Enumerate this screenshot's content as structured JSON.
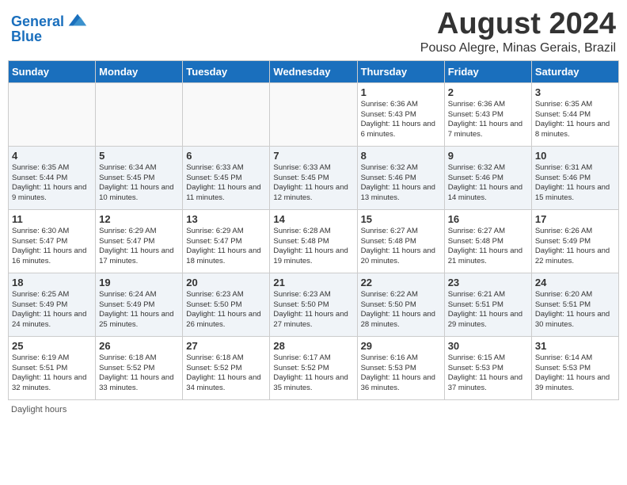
{
  "header": {
    "logo_line1": "General",
    "logo_line2": "Blue",
    "month": "August 2024",
    "location": "Pouso Alegre, Minas Gerais, Brazil"
  },
  "days_of_week": [
    "Sunday",
    "Monday",
    "Tuesday",
    "Wednesday",
    "Thursday",
    "Friday",
    "Saturday"
  ],
  "footer": {
    "label": "Daylight hours"
  },
  "weeks": [
    [
      {
        "num": "",
        "info": ""
      },
      {
        "num": "",
        "info": ""
      },
      {
        "num": "",
        "info": ""
      },
      {
        "num": "",
        "info": ""
      },
      {
        "num": "1",
        "info": "Sunrise: 6:36 AM\nSunset: 5:43 PM\nDaylight: 11 hours and 6 minutes."
      },
      {
        "num": "2",
        "info": "Sunrise: 6:36 AM\nSunset: 5:43 PM\nDaylight: 11 hours and 7 minutes."
      },
      {
        "num": "3",
        "info": "Sunrise: 6:35 AM\nSunset: 5:44 PM\nDaylight: 11 hours and 8 minutes."
      }
    ],
    [
      {
        "num": "4",
        "info": "Sunrise: 6:35 AM\nSunset: 5:44 PM\nDaylight: 11 hours and 9 minutes."
      },
      {
        "num": "5",
        "info": "Sunrise: 6:34 AM\nSunset: 5:45 PM\nDaylight: 11 hours and 10 minutes."
      },
      {
        "num": "6",
        "info": "Sunrise: 6:33 AM\nSunset: 5:45 PM\nDaylight: 11 hours and 11 minutes."
      },
      {
        "num": "7",
        "info": "Sunrise: 6:33 AM\nSunset: 5:45 PM\nDaylight: 11 hours and 12 minutes."
      },
      {
        "num": "8",
        "info": "Sunrise: 6:32 AM\nSunset: 5:46 PM\nDaylight: 11 hours and 13 minutes."
      },
      {
        "num": "9",
        "info": "Sunrise: 6:32 AM\nSunset: 5:46 PM\nDaylight: 11 hours and 14 minutes."
      },
      {
        "num": "10",
        "info": "Sunrise: 6:31 AM\nSunset: 5:46 PM\nDaylight: 11 hours and 15 minutes."
      }
    ],
    [
      {
        "num": "11",
        "info": "Sunrise: 6:30 AM\nSunset: 5:47 PM\nDaylight: 11 hours and 16 minutes."
      },
      {
        "num": "12",
        "info": "Sunrise: 6:29 AM\nSunset: 5:47 PM\nDaylight: 11 hours and 17 minutes."
      },
      {
        "num": "13",
        "info": "Sunrise: 6:29 AM\nSunset: 5:47 PM\nDaylight: 11 hours and 18 minutes."
      },
      {
        "num": "14",
        "info": "Sunrise: 6:28 AM\nSunset: 5:48 PM\nDaylight: 11 hours and 19 minutes."
      },
      {
        "num": "15",
        "info": "Sunrise: 6:27 AM\nSunset: 5:48 PM\nDaylight: 11 hours and 20 minutes."
      },
      {
        "num": "16",
        "info": "Sunrise: 6:27 AM\nSunset: 5:48 PM\nDaylight: 11 hours and 21 minutes."
      },
      {
        "num": "17",
        "info": "Sunrise: 6:26 AM\nSunset: 5:49 PM\nDaylight: 11 hours and 22 minutes."
      }
    ],
    [
      {
        "num": "18",
        "info": "Sunrise: 6:25 AM\nSunset: 5:49 PM\nDaylight: 11 hours and 24 minutes."
      },
      {
        "num": "19",
        "info": "Sunrise: 6:24 AM\nSunset: 5:49 PM\nDaylight: 11 hours and 25 minutes."
      },
      {
        "num": "20",
        "info": "Sunrise: 6:23 AM\nSunset: 5:50 PM\nDaylight: 11 hours and 26 minutes."
      },
      {
        "num": "21",
        "info": "Sunrise: 6:23 AM\nSunset: 5:50 PM\nDaylight: 11 hours and 27 minutes."
      },
      {
        "num": "22",
        "info": "Sunrise: 6:22 AM\nSunset: 5:50 PM\nDaylight: 11 hours and 28 minutes."
      },
      {
        "num": "23",
        "info": "Sunrise: 6:21 AM\nSunset: 5:51 PM\nDaylight: 11 hours and 29 minutes."
      },
      {
        "num": "24",
        "info": "Sunrise: 6:20 AM\nSunset: 5:51 PM\nDaylight: 11 hours and 30 minutes."
      }
    ],
    [
      {
        "num": "25",
        "info": "Sunrise: 6:19 AM\nSunset: 5:51 PM\nDaylight: 11 hours and 32 minutes."
      },
      {
        "num": "26",
        "info": "Sunrise: 6:18 AM\nSunset: 5:52 PM\nDaylight: 11 hours and 33 minutes."
      },
      {
        "num": "27",
        "info": "Sunrise: 6:18 AM\nSunset: 5:52 PM\nDaylight: 11 hours and 34 minutes."
      },
      {
        "num": "28",
        "info": "Sunrise: 6:17 AM\nSunset: 5:52 PM\nDaylight: 11 hours and 35 minutes."
      },
      {
        "num": "29",
        "info": "Sunrise: 6:16 AM\nSunset: 5:53 PM\nDaylight: 11 hours and 36 minutes."
      },
      {
        "num": "30",
        "info": "Sunrise: 6:15 AM\nSunset: 5:53 PM\nDaylight: 11 hours and 37 minutes."
      },
      {
        "num": "31",
        "info": "Sunrise: 6:14 AM\nSunset: 5:53 PM\nDaylight: 11 hours and 39 minutes."
      }
    ]
  ]
}
